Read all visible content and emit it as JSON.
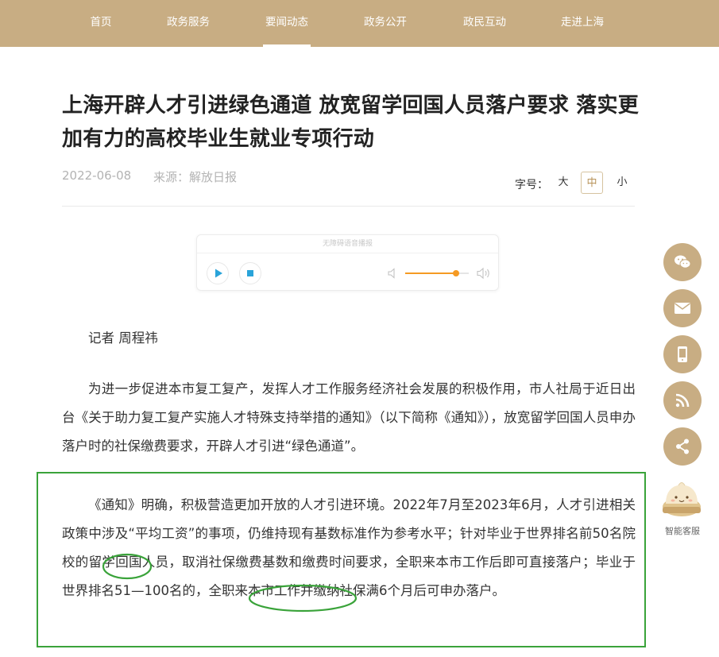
{
  "nav": {
    "items": [
      {
        "label": "首页",
        "active": false
      },
      {
        "label": "政务服务",
        "active": false
      },
      {
        "label": "要闻动态",
        "active": true
      },
      {
        "label": "政务公开",
        "active": false
      },
      {
        "label": "政民互动",
        "active": false
      },
      {
        "label": "走进上海",
        "active": false
      }
    ]
  },
  "article": {
    "title": "上海开辟人才引进绿色通道 放宽留学回国人员落户要求 落实更加有力的高校毕业生就业专项行动",
    "date": "2022-06-08",
    "source": "来源：解放日报",
    "byline": "记者 周程祎",
    "paragraphs": [
      "为进一步促进本市复工复产，发挥人才工作服务经济社会发展的积极作用，市人社局于近日出台《关于助力复工复产实施人才特殊支持举措的通知》（以下简称《通知》），放宽留学回国人员申办落户时的社保缴费要求，开辟人才引进“绿色通道”。",
      "《通知》明确，积极营造更加开放的人才引进环境。2022年7月至2023年6月，人才引进相关政策中涉及“平均工资”的事项，仍维持现有基数标准作为参考水平；针对毕业于世界排名前50名院校的留学回国人员，取消社保缴费基数和缴费时间要求，全职来本市工作后即可直接落户；毕业于世界排名51—100名的，全职来本市工作并缴纳社保满6个月后可申办落户。"
    ]
  },
  "font_size": {
    "label": "字号：",
    "options": [
      "大",
      "中",
      "小"
    ],
    "selected": "中"
  },
  "player": {
    "caption": "无障碍语音播报",
    "volume": 0.8
  },
  "sidebar": {
    "buttons": [
      "wechat-icon",
      "mail-icon",
      "mobile-icon",
      "rss-icon",
      "share-icon"
    ],
    "assistant_label": "智能客服"
  },
  "colors": {
    "nav_bg": "#c8ad83",
    "accent": "#b8935a",
    "annotation": "#3aa33a",
    "player_accent": "#29a3d9",
    "volume": "#f59a23"
  }
}
